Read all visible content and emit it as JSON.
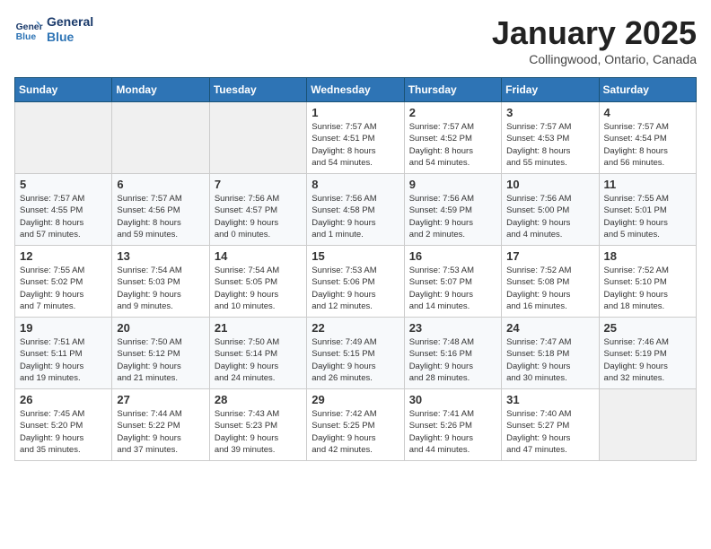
{
  "header": {
    "logo_line1": "General",
    "logo_line2": "Blue",
    "title": "January 2025",
    "subtitle": "Collingwood, Ontario, Canada"
  },
  "days_of_week": [
    "Sunday",
    "Monday",
    "Tuesday",
    "Wednesday",
    "Thursday",
    "Friday",
    "Saturday"
  ],
  "weeks": [
    [
      {
        "day": "",
        "detail": ""
      },
      {
        "day": "",
        "detail": ""
      },
      {
        "day": "",
        "detail": ""
      },
      {
        "day": "1",
        "detail": "Sunrise: 7:57 AM\nSunset: 4:51 PM\nDaylight: 8 hours\nand 54 minutes."
      },
      {
        "day": "2",
        "detail": "Sunrise: 7:57 AM\nSunset: 4:52 PM\nDaylight: 8 hours\nand 54 minutes."
      },
      {
        "day": "3",
        "detail": "Sunrise: 7:57 AM\nSunset: 4:53 PM\nDaylight: 8 hours\nand 55 minutes."
      },
      {
        "day": "4",
        "detail": "Sunrise: 7:57 AM\nSunset: 4:54 PM\nDaylight: 8 hours\nand 56 minutes."
      }
    ],
    [
      {
        "day": "5",
        "detail": "Sunrise: 7:57 AM\nSunset: 4:55 PM\nDaylight: 8 hours\nand 57 minutes."
      },
      {
        "day": "6",
        "detail": "Sunrise: 7:57 AM\nSunset: 4:56 PM\nDaylight: 8 hours\nand 59 minutes."
      },
      {
        "day": "7",
        "detail": "Sunrise: 7:56 AM\nSunset: 4:57 PM\nDaylight: 9 hours\nand 0 minutes."
      },
      {
        "day": "8",
        "detail": "Sunrise: 7:56 AM\nSunset: 4:58 PM\nDaylight: 9 hours\nand 1 minute."
      },
      {
        "day": "9",
        "detail": "Sunrise: 7:56 AM\nSunset: 4:59 PM\nDaylight: 9 hours\nand 2 minutes."
      },
      {
        "day": "10",
        "detail": "Sunrise: 7:56 AM\nSunset: 5:00 PM\nDaylight: 9 hours\nand 4 minutes."
      },
      {
        "day": "11",
        "detail": "Sunrise: 7:55 AM\nSunset: 5:01 PM\nDaylight: 9 hours\nand 5 minutes."
      }
    ],
    [
      {
        "day": "12",
        "detail": "Sunrise: 7:55 AM\nSunset: 5:02 PM\nDaylight: 9 hours\nand 7 minutes."
      },
      {
        "day": "13",
        "detail": "Sunrise: 7:54 AM\nSunset: 5:03 PM\nDaylight: 9 hours\nand 9 minutes."
      },
      {
        "day": "14",
        "detail": "Sunrise: 7:54 AM\nSunset: 5:05 PM\nDaylight: 9 hours\nand 10 minutes."
      },
      {
        "day": "15",
        "detail": "Sunrise: 7:53 AM\nSunset: 5:06 PM\nDaylight: 9 hours\nand 12 minutes."
      },
      {
        "day": "16",
        "detail": "Sunrise: 7:53 AM\nSunset: 5:07 PM\nDaylight: 9 hours\nand 14 minutes."
      },
      {
        "day": "17",
        "detail": "Sunrise: 7:52 AM\nSunset: 5:08 PM\nDaylight: 9 hours\nand 16 minutes."
      },
      {
        "day": "18",
        "detail": "Sunrise: 7:52 AM\nSunset: 5:10 PM\nDaylight: 9 hours\nand 18 minutes."
      }
    ],
    [
      {
        "day": "19",
        "detail": "Sunrise: 7:51 AM\nSunset: 5:11 PM\nDaylight: 9 hours\nand 19 minutes."
      },
      {
        "day": "20",
        "detail": "Sunrise: 7:50 AM\nSunset: 5:12 PM\nDaylight: 9 hours\nand 21 minutes."
      },
      {
        "day": "21",
        "detail": "Sunrise: 7:50 AM\nSunset: 5:14 PM\nDaylight: 9 hours\nand 24 minutes."
      },
      {
        "day": "22",
        "detail": "Sunrise: 7:49 AM\nSunset: 5:15 PM\nDaylight: 9 hours\nand 26 minutes."
      },
      {
        "day": "23",
        "detail": "Sunrise: 7:48 AM\nSunset: 5:16 PM\nDaylight: 9 hours\nand 28 minutes."
      },
      {
        "day": "24",
        "detail": "Sunrise: 7:47 AM\nSunset: 5:18 PM\nDaylight: 9 hours\nand 30 minutes."
      },
      {
        "day": "25",
        "detail": "Sunrise: 7:46 AM\nSunset: 5:19 PM\nDaylight: 9 hours\nand 32 minutes."
      }
    ],
    [
      {
        "day": "26",
        "detail": "Sunrise: 7:45 AM\nSunset: 5:20 PM\nDaylight: 9 hours\nand 35 minutes."
      },
      {
        "day": "27",
        "detail": "Sunrise: 7:44 AM\nSunset: 5:22 PM\nDaylight: 9 hours\nand 37 minutes."
      },
      {
        "day": "28",
        "detail": "Sunrise: 7:43 AM\nSunset: 5:23 PM\nDaylight: 9 hours\nand 39 minutes."
      },
      {
        "day": "29",
        "detail": "Sunrise: 7:42 AM\nSunset: 5:25 PM\nDaylight: 9 hours\nand 42 minutes."
      },
      {
        "day": "30",
        "detail": "Sunrise: 7:41 AM\nSunset: 5:26 PM\nDaylight: 9 hours\nand 44 minutes."
      },
      {
        "day": "31",
        "detail": "Sunrise: 7:40 AM\nSunset: 5:27 PM\nDaylight: 9 hours\nand 47 minutes."
      },
      {
        "day": "",
        "detail": ""
      }
    ]
  ]
}
